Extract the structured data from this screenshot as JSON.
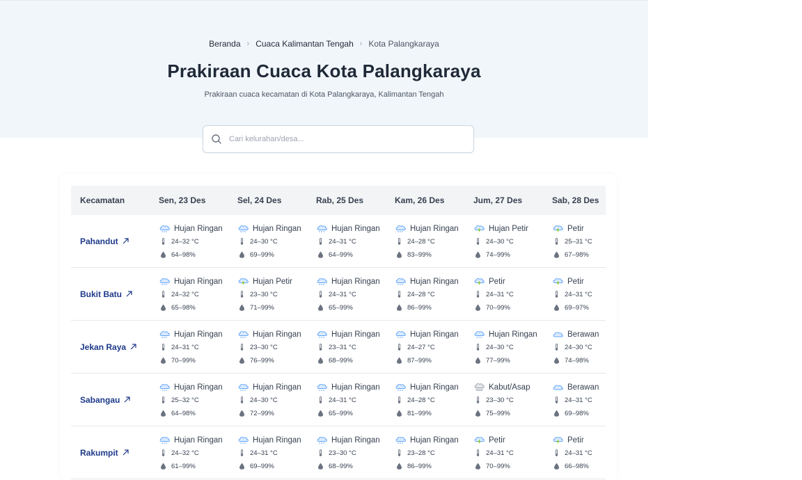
{
  "breadcrumb": [
    {
      "label": "Beranda"
    },
    {
      "label": "Cuaca Kalimantan Tengah"
    },
    {
      "label": "Kota Palangkaraya"
    }
  ],
  "title": "Prakiraan Cuaca Kota Palangkaraya",
  "subtitle": "Prakiraan cuaca kecamatan di Kota Palangkaraya, Kalimantan Tengah",
  "search": {
    "placeholder": "Cari kelurahan/desa..."
  },
  "table": {
    "header_label": "Kecamatan",
    "days": [
      "Sen, 23 Des",
      "Sel, 24 Des",
      "Rab, 25 Des",
      "Kam, 26 Des",
      "Jum, 27 Des",
      "Sab, 28 Des"
    ],
    "rows": [
      {
        "name": "Pahandut",
        "cells": [
          {
            "cond": "Hujan Ringan",
            "icon": "rain-icon",
            "temp": "24–32 °C",
            "hum": "64–98%"
          },
          {
            "cond": "Hujan Ringan",
            "icon": "rain-icon",
            "temp": "24–30 °C",
            "hum": "69–99%"
          },
          {
            "cond": "Hujan Ringan",
            "icon": "rain-icon",
            "temp": "24–31 °C",
            "hum": "64–99%"
          },
          {
            "cond": "Hujan Ringan",
            "icon": "rain-icon",
            "temp": "24–28 °C",
            "hum": "83–99%"
          },
          {
            "cond": "Hujan Petir",
            "icon": "thunder-icon",
            "temp": "24–30 °C",
            "hum": "74–99%"
          },
          {
            "cond": "Petir",
            "icon": "thunder-icon",
            "temp": "25–31 °C",
            "hum": "67–98%"
          }
        ]
      },
      {
        "name": "Bukit Batu",
        "cells": [
          {
            "cond": "Hujan Ringan",
            "icon": "rain-icon",
            "temp": "24–32 °C",
            "hum": "65–98%"
          },
          {
            "cond": "Hujan Petir",
            "icon": "thunder-icon",
            "temp": "23–30 °C",
            "hum": "71–99%"
          },
          {
            "cond": "Hujan Ringan",
            "icon": "rain-icon",
            "temp": "24–31 °C",
            "hum": "65–99%"
          },
          {
            "cond": "Hujan Ringan",
            "icon": "rain-icon",
            "temp": "24–28 °C",
            "hum": "86–99%"
          },
          {
            "cond": "Petir",
            "icon": "thunder-icon",
            "temp": "24–31 °C",
            "hum": "70–99%"
          },
          {
            "cond": "Petir",
            "icon": "thunder-icon",
            "temp": "24–31 °C",
            "hum": "69–97%"
          }
        ]
      },
      {
        "name": "Jekan Raya",
        "cells": [
          {
            "cond": "Hujan Ringan",
            "icon": "rain-icon",
            "temp": "24–31 °C",
            "hum": "70–99%"
          },
          {
            "cond": "Hujan Ringan",
            "icon": "rain-icon",
            "temp": "23–30 °C",
            "hum": "76–99%"
          },
          {
            "cond": "Hujan Ringan",
            "icon": "rain-icon",
            "temp": "23–31 °C",
            "hum": "68–99%"
          },
          {
            "cond": "Hujan Ringan",
            "icon": "rain-icon",
            "temp": "24–27 °C",
            "hum": "87–99%"
          },
          {
            "cond": "Hujan Ringan",
            "icon": "rain-icon",
            "temp": "24–30 °C",
            "hum": "77–99%"
          },
          {
            "cond": "Berawan",
            "icon": "cloud-icon",
            "temp": "24–30 °C",
            "hum": "74–98%"
          }
        ]
      },
      {
        "name": "Sabangau",
        "cells": [
          {
            "cond": "Hujan Ringan",
            "icon": "rain-icon",
            "temp": "25–32 °C",
            "hum": "64–98%"
          },
          {
            "cond": "Hujan Ringan",
            "icon": "rain-icon",
            "temp": "24–30 °C",
            "hum": "72–99%"
          },
          {
            "cond": "Hujan Ringan",
            "icon": "rain-icon",
            "temp": "24–31 °C",
            "hum": "65–99%"
          },
          {
            "cond": "Hujan Ringan",
            "icon": "rain-icon",
            "temp": "24–28 °C",
            "hum": "81–99%"
          },
          {
            "cond": "Kabut/Asap",
            "icon": "fog-icon",
            "temp": "23–30 °C",
            "hum": "75–99%"
          },
          {
            "cond": "Berawan",
            "icon": "cloud-icon",
            "temp": "24–31 °C",
            "hum": "69–98%"
          }
        ]
      },
      {
        "name": "Rakumpit",
        "cells": [
          {
            "cond": "Hujan Ringan",
            "icon": "rain-icon",
            "temp": "24–32 °C",
            "hum": "61–99%"
          },
          {
            "cond": "Hujan Ringan",
            "icon": "rain-icon",
            "temp": "24–31 °C",
            "hum": "69–99%"
          },
          {
            "cond": "Hujan Ringan",
            "icon": "rain-icon",
            "temp": "23–30 °C",
            "hum": "68–99%"
          },
          {
            "cond": "Hujan Ringan",
            "icon": "rain-icon",
            "temp": "23–28 °C",
            "hum": "86–99%"
          },
          {
            "cond": "Petir",
            "icon": "thunder-icon",
            "temp": "24–31 °C",
            "hum": "70–99%"
          },
          {
            "cond": "Petir",
            "icon": "thunder-icon",
            "temp": "24–31 °C",
            "hum": "66–98%"
          }
        ]
      }
    ]
  },
  "colors": {
    "hero_bg": "#f1f6fa",
    "link": "#1e3a8a",
    "header_bg": "#f3f4f6",
    "cloud_fill": "#dbeafe",
    "cloud_stroke": "#60a5fa",
    "bolt": "#84cc16"
  }
}
